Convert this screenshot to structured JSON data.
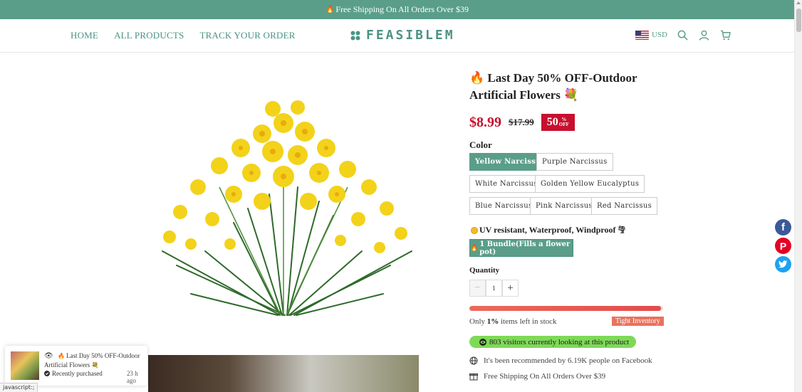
{
  "announcement": "Free Shipping On All Orders Over $39",
  "nav": {
    "home": "HOME",
    "all_products": "ALL PRODUCTS",
    "track_order": "TRACK YOUR ORDER"
  },
  "logo": "FEASIBLEM",
  "currency": "USD",
  "product": {
    "title": "Last Day 50% OFF-Outdoor Artificial Flowers",
    "price": "$8.99",
    "old_price": "$17.99",
    "discount_num": "50",
    "discount_pct": "%",
    "discount_off": "OFF",
    "color_label": "Color",
    "colors": [
      "Yellow Narcissus",
      "Purple Narcissus",
      "White Narcissus",
      "Golden Yellow Eucalyptus",
      "Blue Narcissus",
      "Pink Narcissus",
      "Red Narcissus"
    ],
    "selected_color": "Yellow Narcissus",
    "feature": "UV resistant, Waterproof,  Windproof",
    "bundle": "1 Bundle(Fills a flower pot)",
    "quantity_label": "Quantity",
    "quantity": "1",
    "stock_fraction": 0.99,
    "stock_prefix": "Only",
    "stock_count": "1%",
    "stock_suffix": "items left in stock",
    "tight_inventory": "Tight Inventory",
    "visitors": "803 visitors currently looking at this product",
    "perks": [
      "It's been recommended by 6.19K people on Facebook",
      "Free Shipping On All Orders Over $39"
    ]
  },
  "popup": {
    "title": "Last Day 50% OFF-Outdoor Artificial Flowers",
    "status": "Recently purchased",
    "time": "23 h ago"
  },
  "status_bar": "javascript:;",
  "colors": {
    "accent": "#5a9e8a",
    "price_red": "#c8102e",
    "visitor_green": "#7ed957",
    "tight_red": "#e8725f"
  }
}
